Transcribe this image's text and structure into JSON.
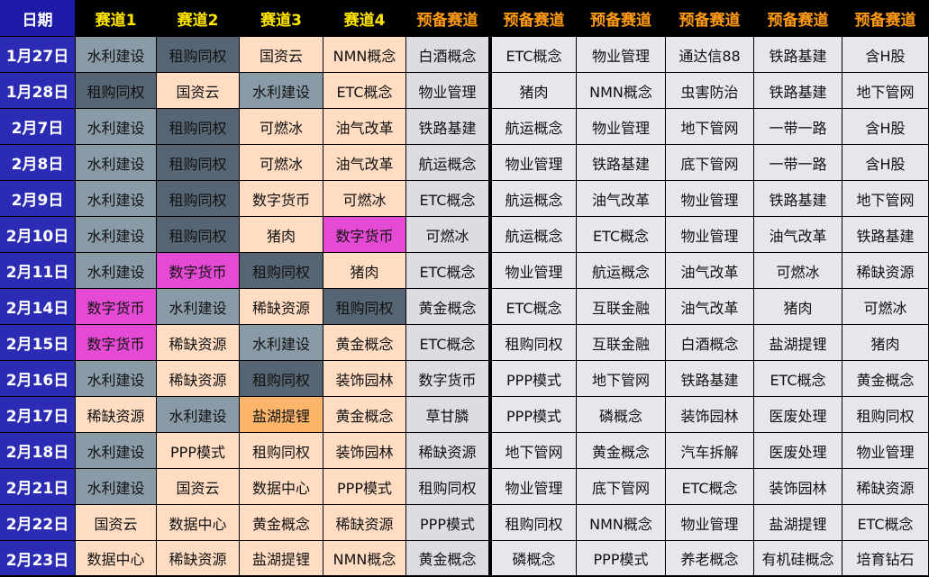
{
  "header": {
    "date": "日期",
    "lane1": "赛道1",
    "lane2": "赛道2",
    "lane3": "赛道3",
    "lane4": "赛道4",
    "spare": "预备赛道"
  },
  "colors": {
    "date_bg": "#2b2bb4",
    "header_bg": "#000000",
    "lane_header_text": "#ffe600",
    "spare_header_text": "#ff9a14",
    "shuili_cell": "#8a9ba8",
    "zugou_cell": "#566573",
    "peach_cell": "#ffdcc2",
    "pink_cell": "#e54ad4",
    "yanhu_cell": "#fcb56a",
    "grey_cell": "#dcdde2",
    "spare_cell": "#e6e6ec"
  },
  "rows": [
    {
      "date": "1月27日",
      "cells": [
        "水利建设",
        "租购同权",
        "国资云",
        "NMN概念",
        "白酒概念",
        "ETC概念",
        "物业管理",
        "通达信88",
        "铁路基建",
        "含H股"
      ]
    },
    {
      "date": "1月28日",
      "cells": [
        "租购同权",
        "国资云",
        "水利建设",
        "ETC概念",
        "物业管理",
        "猪肉",
        "NMN概念",
        "虫害防治",
        "铁路基建",
        "地下管网"
      ]
    },
    {
      "date": "2月7日",
      "cells": [
        "水利建设",
        "租购同权",
        "可燃冰",
        "油气改革",
        "铁路基建",
        "航运概念",
        "物业管理",
        "地下管网",
        "一带一路",
        "含H股"
      ]
    },
    {
      "date": "2月8日",
      "cells": [
        "水利建设",
        "租购同权",
        "可燃冰",
        "油气改革",
        "航运概念",
        "物业管理",
        "铁路基建",
        "底下管网",
        "一带一路",
        "含H股"
      ]
    },
    {
      "date": "2月9日",
      "cells": [
        "水利建设",
        "租购同权",
        "数字货币",
        "可燃冰",
        "ETC概念",
        "航运概念",
        "油气改革",
        "物业管理",
        "铁路基建",
        "地下管网"
      ]
    },
    {
      "date": "2月10日",
      "cells": [
        "水利建设",
        "租购同权",
        "猪肉",
        "数字货币",
        "可燃冰",
        "航运概念",
        "ETC概念",
        "物业管理",
        "油气改革",
        "铁路基建"
      ]
    },
    {
      "date": "2月11日",
      "cells": [
        "水利建设",
        "数字货币",
        "租购同权",
        "猪肉",
        "ETC概念",
        "物业管理",
        "航运概念",
        "油气改革",
        "可燃冰",
        "稀缺资源"
      ]
    },
    {
      "date": "2月14日",
      "cells": [
        "数字货币",
        "水利建设",
        "稀缺资源",
        "租购同权",
        "黄金概念",
        "ETC概念",
        "互联金融",
        "油气改革",
        "猪肉",
        "可燃冰"
      ]
    },
    {
      "date": "2月15日",
      "cells": [
        "数字货币",
        "稀缺资源",
        "水利建设",
        "黄金概念",
        "ETC概念",
        "租购同权",
        "互联金融",
        "白酒概念",
        "盐湖提锂",
        "猪肉"
      ]
    },
    {
      "date": "2月16日",
      "cells": [
        "水利建设",
        "稀缺资源",
        "租购同权",
        "装饰园林",
        "数字货币",
        "PPP模式",
        "地下管网",
        "铁路基建",
        "ETC概念",
        "黄金概念"
      ]
    },
    {
      "date": "2月17日",
      "cells": [
        "稀缺资源",
        "水利建设",
        "盐湖提锂",
        "黄金概念",
        "草甘膦",
        "PPP模式",
        "磷概念",
        "装饰园林",
        "医废处理",
        "租购同权"
      ]
    },
    {
      "date": "2月18日",
      "cells": [
        "水利建设",
        "PPP模式",
        "租购同权",
        "装饰园林",
        "稀缺资源",
        "地下管网",
        "黄金概念",
        "汽车拆解",
        "医废处理",
        "物业管理"
      ]
    },
    {
      "date": "2月21日",
      "cells": [
        "水利建设",
        "国资云",
        "数据中心",
        "PPP模式",
        "租购同权",
        "物业管理",
        "底下管网",
        "ETC概念",
        "装饰园林",
        "稀缺资源"
      ]
    },
    {
      "date": "2月22日",
      "cells": [
        "国资云",
        "数据中心",
        "黄金概念",
        "稀缺资源",
        "PPP模式",
        "租购同权",
        "NMN概念",
        "物业管理",
        "盐湖提锂",
        "ETC概念"
      ]
    },
    {
      "date": "2月23日",
      "cells": [
        "数据中心",
        "稀缺资源",
        "盐湖提锂",
        "NMN概念",
        "黄金概念",
        "磷概念",
        "PPP模式",
        "养老概念",
        "有机硅概念",
        "培育钻石"
      ]
    }
  ]
}
